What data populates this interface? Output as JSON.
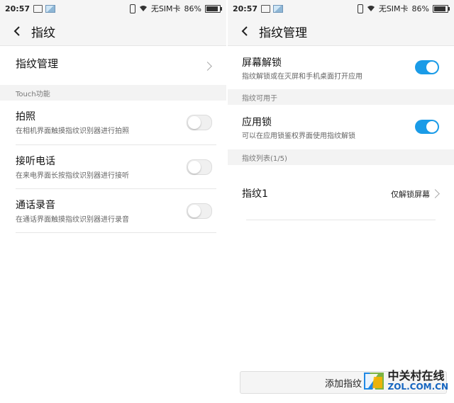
{
  "left": {
    "status": {
      "time": "20:57",
      "carrier": "无SIM卡",
      "battery": "86%"
    },
    "header": {
      "title": "指纹"
    },
    "manage_row": {
      "label": "指纹管理"
    },
    "section_touch": "Touch功能",
    "items": [
      {
        "title": "拍照",
        "subtitle": "在相机界面触摸指纹识别器进行拍照",
        "enabled": false
      },
      {
        "title": "接听电话",
        "subtitle": "在来电界面长按指纹识别器进行接听",
        "enabled": false
      },
      {
        "title": "通话录音",
        "subtitle": "在通话界面触摸指纹识别器进行录音",
        "enabled": false
      }
    ]
  },
  "right": {
    "status": {
      "time": "20:57",
      "carrier": "无SIM卡",
      "battery": "86%"
    },
    "header": {
      "title": "指纹管理"
    },
    "screen_unlock": {
      "title": "屏幕解锁",
      "subtitle": "指纹解锁或在灭屏和手机桌面打开应用",
      "enabled": true
    },
    "section_usable": "指纹可用于",
    "app_lock": {
      "title": "应用锁",
      "subtitle": "可以在应用锁鉴权界面使用指纹解锁",
      "enabled": true
    },
    "section_list": "指纹列表(1/5)",
    "fingerprint": {
      "name": "指纹1",
      "value": "仅解锁屏幕"
    },
    "add_button": "添加指纹"
  },
  "watermark": {
    "cn": "中关村在线",
    "en": "ZOL.COM.CN"
  },
  "colors": {
    "toggle_on": "#1a9be7",
    "header_bg": "#f5f5f5",
    "section_bg": "#f3f3f3"
  }
}
